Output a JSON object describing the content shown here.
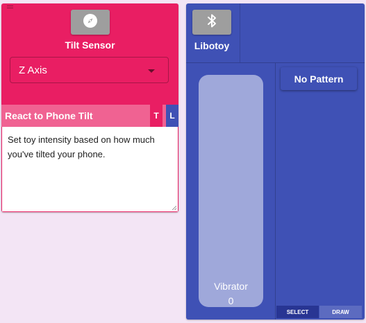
{
  "tilt_panel": {
    "title": "Tilt Sensor",
    "icon": "compass-icon",
    "axis_select": {
      "value": "Z Axis"
    },
    "mode": {
      "label": "React to Phone Tilt",
      "toggle_t": "T",
      "toggle_l": "L"
    },
    "description": "Set toy intensity based on how much you've tilted your phone."
  },
  "toy_panel": {
    "title": "Libotoy",
    "icon": "bluetooth-icon",
    "vibrator": {
      "label": "Vibrator",
      "value": "0"
    },
    "pattern_button": "No Pattern",
    "tabs": {
      "select": "SELECT",
      "draw": "DRAW"
    }
  },
  "colors": {
    "background": "#f3e5f5",
    "tilt_panel": "#e91e63",
    "mode_bar": "#f06292",
    "toy_panel": "#3f51b5",
    "slider": "#9fa8da",
    "icon_button": "#9e9e9e"
  }
}
